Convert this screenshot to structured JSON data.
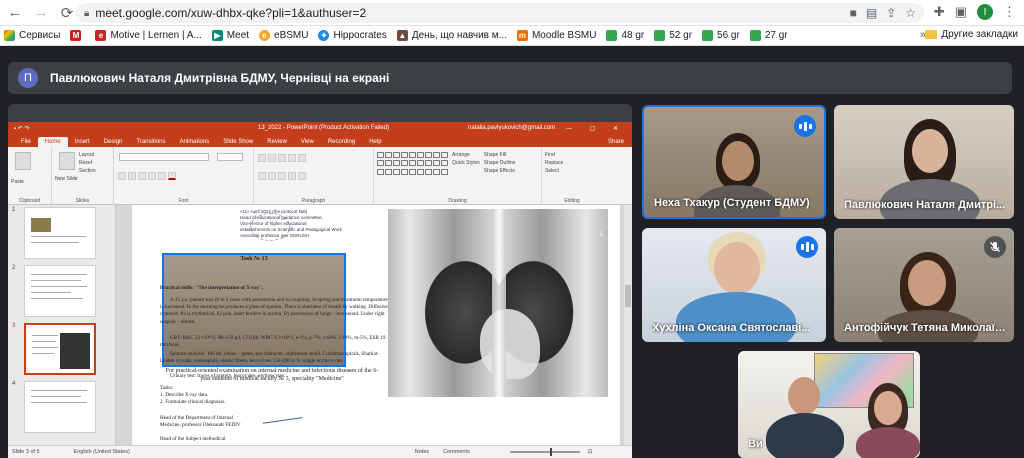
{
  "browser": {
    "url": "meet.google.com/xuw-dhbx-qke?pli=1&authuser=2",
    "profile_initial": "I",
    "bookmarks": [
      {
        "label": "Сервисы",
        "color": "#ea4335"
      },
      {
        "label": "",
        "color": "#c5221f"
      },
      {
        "label": "Motive | Lernen | A...",
        "color": "#c62828"
      },
      {
        "label": "Meet",
        "color": "#00897b"
      },
      {
        "label": "eBSMU",
        "color": "#f9a825"
      },
      {
        "label": "Hippocrates",
        "color": "#1e88e5"
      },
      {
        "label": "День, що навчив м...",
        "color": "#6d4c41"
      },
      {
        "label": "Moodle BSMU",
        "color": "#ef6c00"
      },
      {
        "label": "48 gr",
        "color": "#34a853"
      },
      {
        "label": "52 gr",
        "color": "#34a853"
      },
      {
        "label": "56 gr",
        "color": "#34a853"
      },
      {
        "label": "27 gr",
        "color": "#34a853"
      }
    ],
    "bookmarks_more": "»",
    "other_bookmarks": "Другие закладки"
  },
  "meet": {
    "presenter_initial": "П",
    "presenter_text": "Павлюкович Наталя Дмитрівна БДМУ, Чернівці на екрані",
    "participants": [
      {
        "name": "Неха Тхакур (Студент БДМУ)",
        "state": "speaking"
      },
      {
        "name": "Павлюкович Наталя Дмитрі...",
        "state": "none"
      },
      {
        "name": "Хухліна Оксана Святославі...",
        "state": "speaking"
      },
      {
        "name": "Антофійчук Тетяна Миколаїв...",
        "state": "muted"
      },
      {
        "name": "Ви",
        "state": "none"
      }
    ]
  },
  "ppt": {
    "title": "13_2022 - PowerPoint (Product Activation Failed)",
    "user": "natalia.pavlyukovich@gmail.com",
    "tabs": [
      "File",
      "Home",
      "Insert",
      "Design",
      "Transitions",
      "Animations",
      "Slide Show",
      "Review",
      "View",
      "Recording",
      "Help"
    ],
    "active_tab": "Home",
    "share": "Share",
    "ribbon_groups": [
      "Clipboard",
      "Slides",
      "Font",
      "Paragraph",
      "Drawing",
      "Editing"
    ],
    "ribbon_buttons": {
      "paste": "Paste",
      "new_slide": "New Slide",
      "layout": "Layout",
      "reset": "Reset",
      "section": "Section",
      "arrange": "Arrange",
      "quick_styles": "Quick Styles",
      "shape_fill": "Shape Fill",
      "shape_outline": "Shape Outline",
      "shape_effects": "Shape Effects",
      "find": "Find",
      "replace": "Replace",
      "select": "Select"
    },
    "thumb_numbers": [
      "1",
      "2",
      "3",
      "4"
    ],
    "status": {
      "slide": "Slide 3 of 5",
      "language": "English (United States)",
      "notes": "Notes",
      "comments": "Comments"
    },
    "slide": {
      "stamp_lines": [
        "«11» April 2022 (the protocol №8)",
        "Head of educational guidance committee,",
        "Vice-Rector of higher educational",
        "establishments on Scientific and Pedagogical Work",
        "Associate professor         Igor GERUSH"
      ],
      "task_number": "Task № 13",
      "task_subtitle": "For practical-oriented examination on internal medicine and infectious diseases of the 6-year students of medical faculty № 3, speciality \"Medicine\"",
      "skill": "Practical skills: \"The interpretation of X-ray\".",
      "case": "A 35 y.o. patient was ill in 5 years with pneumonia and is coughing. In spring and in autumn temperature is increased. In the morning he produces a glass of sputum. There is shortness of breath by walking. Diffusive cyanosis. Pa is rhythmical, 82 p/m, heart borders in norma. By percussion of lungs – box sound. Under right scapula – obtuse.",
      "blood": "CBT: RBC 3,1×10¹²/l, Hb-150 g/l, CI 0,88, WBC 9,1×10⁹/l, e-1%, p-7%, s-68%, l-19%, m-5%, ESR 19 mm/hour.",
      "sputum": "Sputum analysis: 160 ml, odour – green, pus character, unpleasant smell. Curshman spirals, Sharkot-Leiden crystals, eosinophils, elastic fibers, leucocytes 150-200 in fv, single erythrocytes.",
      "urine": "Urinary test: traces of protein, leucocytes, erythrocytes.",
      "tasks_header": "Tasks:",
      "task1": "1. Describe X-ray data.",
      "task2": "2. Formulate clinical diagnosis.",
      "head_line1": "Head of the Department of Internal",
      "head_line2": "Medicine, professor                    Oleksandr FEDIV",
      "head_line3": "Head of the Subject methodical",
      "xray_mark": "L"
    }
  }
}
